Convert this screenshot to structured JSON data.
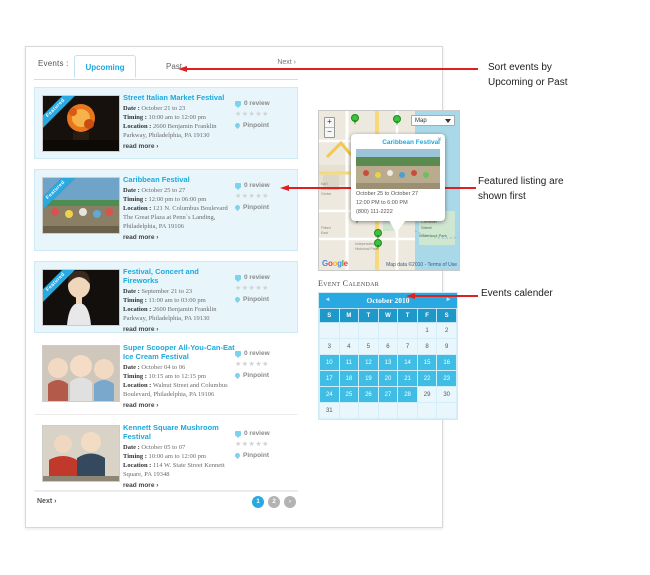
{
  "tabs": {
    "label": "Events :",
    "active": "Upcoming",
    "inactive": "Past",
    "next_link": "Next ›"
  },
  "listings": [
    {
      "ribbon": "Featured",
      "title": "Street Italian Market Festival",
      "date_label": "Date :",
      "date_value": "October 21 to 23",
      "timing_label": "Timing :",
      "timing_value": "10:00 am to 12:00 pm",
      "location_label": "Location :",
      "location_value": "2600 Benjamin Franklin Parkway, Philadelphia, PA 19130",
      "read_more": "read more ›",
      "reviews": "0 review",
      "stars": "★★★★★",
      "pinpoint": "Pinpoint"
    },
    {
      "ribbon": "Featured",
      "title": "Caribbean Festival",
      "date_label": "Date :",
      "date_value": "October 25 to 27",
      "timing_label": "Timing :",
      "timing_value": "12:00 pm to 06:00 pm",
      "location_label": "Location :",
      "location_value": "121 N. Columbus Boulevard The Great Plaza at Penn`s Landing, Philadelphia, PA 19106",
      "read_more": "read more ›",
      "reviews": "0 review",
      "stars": "★★★★★",
      "pinpoint": "Pinpoint"
    },
    {
      "ribbon": "Featured",
      "title": "Festival, Concert and Fireworks",
      "date_label": "Date :",
      "date_value": "September 21 to 23",
      "timing_label": "Timing :",
      "timing_value": "11:00 am to 03:00 pm",
      "location_label": "Location :",
      "location_value": "2600 Benjamin Franklin Parkway, Philadelphia, PA 19130",
      "read_more": "read more ›",
      "reviews": "0 review",
      "stars": "★★★★★",
      "pinpoint": "Pinpoint"
    },
    {
      "ribbon": "",
      "title": "Super Scooper All-You-Can-Eat Ice Cream Festival",
      "date_label": "Date :",
      "date_value": "October 04 to 06",
      "timing_label": "Timing :",
      "timing_value": "10:15 am to 12:15 pm",
      "location_label": "Location :",
      "location_value": "Walnut Street and Columbus Boulevard, Philadelphia, PA 19106",
      "read_more": "read more ›",
      "reviews": "0 review",
      "stars": "★★★★★",
      "pinpoint": "Pinpoint"
    },
    {
      "ribbon": "",
      "title": "Kennett Square Mushroom Festival",
      "date_label": "Date :",
      "date_value": "October 05 to 07",
      "timing_label": "Timing :",
      "timing_value": "10:00 am to 12:00 pm",
      "location_label": "Location :",
      "location_value": "114 W. State Street Kennett Square, PA 19348",
      "read_more": "read more ›",
      "reviews": "0 review",
      "stars": "★★★★★",
      "pinpoint": "Pinpoint"
    }
  ],
  "pager": {
    "next": "Next ›",
    "buttons": [
      "1",
      "2",
      "›"
    ]
  },
  "map": {
    "map_type": "Map",
    "zoom_in": "+",
    "zoom_out": "−",
    "logo": "Google",
    "terms": "Map data ©2010 - Terms of Use",
    "info": {
      "title": "Caribbean Festival",
      "close": "✕",
      "dates": "October 25 to October 27",
      "time": "12:00 PM to 6:00 PM",
      "phone": "(800) 111-2222"
    }
  },
  "calendar": {
    "heading": "Event Calendar",
    "title": "October 2010",
    "prev": "◄",
    "next": "►",
    "daynames": [
      "S",
      "M",
      "T",
      "W",
      "T",
      "F",
      "S"
    ],
    "weeks": [
      [
        null,
        null,
        null,
        null,
        null,
        1,
        2
      ],
      [
        3,
        4,
        5,
        6,
        7,
        8,
        9
      ],
      [
        10,
        11,
        12,
        13,
        14,
        15,
        16
      ],
      [
        17,
        18,
        19,
        20,
        21,
        22,
        23
      ],
      [
        24,
        25,
        26,
        27,
        28,
        29,
        30
      ],
      [
        31,
        null,
        null,
        null,
        null,
        null,
        null
      ]
    ],
    "highlighted": [
      10,
      11,
      12,
      13,
      14,
      15,
      16,
      17,
      18,
      19,
      20,
      21,
      22,
      23,
      24,
      25,
      26,
      27,
      28
    ]
  },
  "annotations": [
    {
      "text_line1": "Sort events by",
      "text_line2": "Upcoming or Past"
    },
    {
      "text_line1": "Featured listing are",
      "text_line2": "shown first"
    },
    {
      "text_line1": "Events calender",
      "text_line2": ""
    }
  ],
  "colors": {
    "accent": "#29a9e1",
    "featured_bg": "#e8f6fc",
    "arrow_red": "#e02020"
  }
}
